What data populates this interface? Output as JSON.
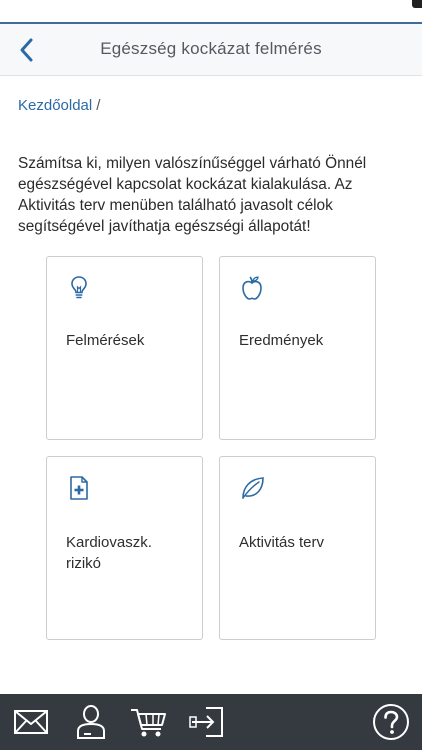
{
  "header": {
    "title": "Egészség kockázat felmérés",
    "back_icon": "chevron-left-icon"
  },
  "breadcrumb": {
    "home_label": "Kezdőoldal",
    "separator": "/"
  },
  "intro_text": "Számítsa ki, milyen valószínűséggel várható Önnél egészségével kapcsolat kockázat kialakulása. Az Aktivitás terv menüben található javasolt célok segítségével javíthatja egészségi állapotát!",
  "tiles": [
    {
      "label": "Felmérések",
      "icon": "lightbulb-icon"
    },
    {
      "label": "Eredmények",
      "icon": "apple-icon"
    },
    {
      "label": "Kardiovaszk. rizikó",
      "icon": "medical-document-icon"
    },
    {
      "label": "Aktivitás terv",
      "icon": "leaf-icon"
    }
  ],
  "bottom_bar": {
    "icons": [
      "mail-icon",
      "user-icon",
      "cart-icon",
      "logout-icon",
      "help-icon"
    ]
  },
  "colors": {
    "accent": "#2c6aa5",
    "header_line": "#3f6d99",
    "bottom_bar": "#353a40"
  }
}
